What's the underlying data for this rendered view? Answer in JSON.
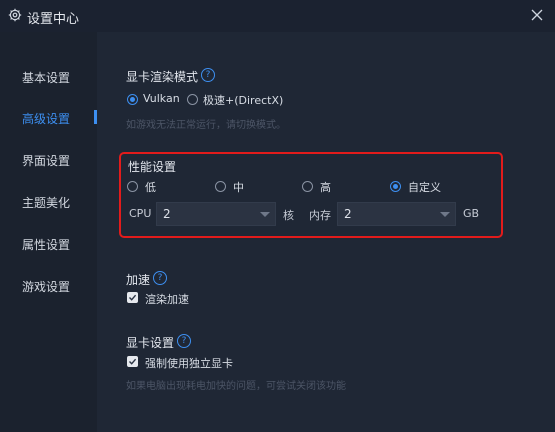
{
  "window": {
    "title": "设置中心"
  },
  "sidebar": {
    "items": [
      {
        "label": "基本设置",
        "active": false
      },
      {
        "label": "高级设置",
        "active": true
      },
      {
        "label": "界面设置",
        "active": false
      },
      {
        "label": "主题美化",
        "active": false
      },
      {
        "label": "属性设置",
        "active": false
      },
      {
        "label": "游戏设置",
        "active": false
      }
    ]
  },
  "render_mode": {
    "title": "显卡渲染模式",
    "options": [
      "Vulkan",
      "极速+(DirectX)"
    ],
    "selected": "Vulkan",
    "hint": "如游戏无法正常运行，请切换模式。"
  },
  "performance": {
    "title": "性能设置",
    "options": [
      "低",
      "中",
      "高",
      "自定义"
    ],
    "selected": "自定义",
    "cpu_label": "CPU",
    "cpu_value": "2",
    "cpu_unit": "核",
    "memory_label": "内存",
    "memory_value": "2",
    "memory_unit": "GB"
  },
  "acceleration": {
    "title": "加速",
    "checkbox_label": "渲染加速",
    "checked": true
  },
  "gpu": {
    "title": "显卡设置",
    "checkbox_label": "强制使用独立显卡",
    "checked": true,
    "hint": "如果电脑出现耗电加快的问题，可尝试关闭该功能"
  },
  "colors": {
    "accent": "#3d8ff0",
    "highlight_border": "#e21b1b",
    "background": "#1f2735"
  }
}
